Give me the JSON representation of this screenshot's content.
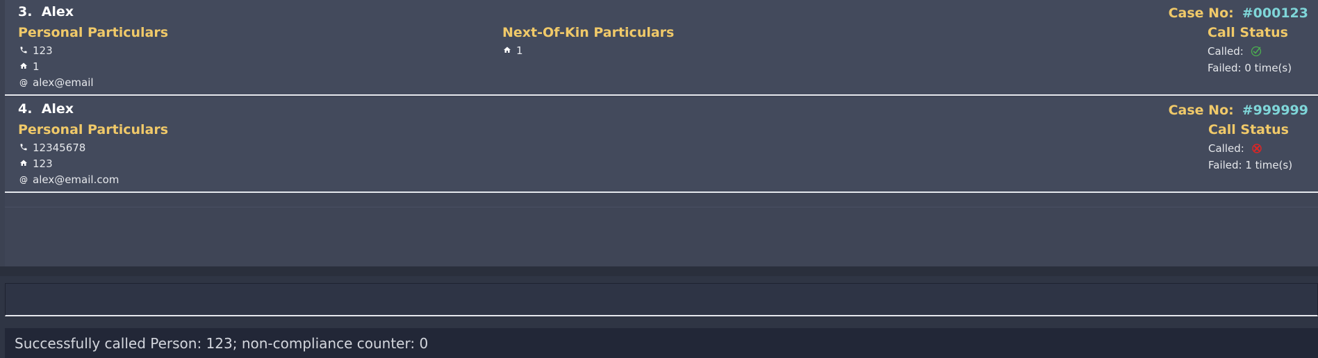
{
  "persons": [
    {
      "index_label": "3.",
      "name": "Alex",
      "case_label": "Case No:",
      "case_number": "#000123",
      "personal_title": "Personal Particulars",
      "phone": "123",
      "address": "1",
      "email": "alex@email",
      "nok_title": "Next-Of-Kin Particulars",
      "nok_address": "1",
      "call_status_title": "Call Status",
      "called_label": "Called:",
      "called_state": "success",
      "failed_text": "Failed: 0 time(s)"
    },
    {
      "index_label": "4.",
      "name": "Alex",
      "case_label": "Case No:",
      "case_number": "#999999",
      "personal_title": "Personal Particulars",
      "phone": "12345678",
      "address": "123",
      "email": "alex@email.com",
      "call_status_title": "Call Status",
      "called_label": "Called:",
      "called_state": "failed",
      "failed_text": "Failed: 1 time(s)"
    }
  ],
  "command": {
    "value": "",
    "placeholder": ""
  },
  "result": {
    "message": "Successfully called Person: 123; non-compliance counter: 0"
  },
  "icons": {
    "phone": "phone-icon",
    "home": "home-icon",
    "email": "at-icon",
    "called_success": "check-circle-icon",
    "called_failed": "x-circle-icon"
  },
  "colors": {
    "section_title": "#f0c969",
    "case_number": "#7fd6d9",
    "success": "#4caf50",
    "failure": "#e02424"
  }
}
